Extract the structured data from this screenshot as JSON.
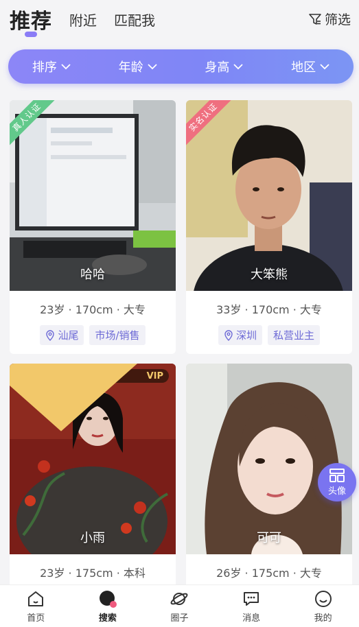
{
  "header": {
    "tabs": [
      "推荐",
      "附近",
      "匹配我"
    ],
    "active_tab": "推荐",
    "filter_label": "筛选"
  },
  "filter_bar": {
    "items": [
      "排序",
      "年龄",
      "身高",
      "地区"
    ]
  },
  "cards": [
    {
      "name": "哈哈",
      "badge": "真人认证",
      "info": "23岁 · 170cm · 大专",
      "location": "汕尾",
      "job": "市场/销售"
    },
    {
      "name": "大笨熊",
      "badge": "实名认证",
      "info": "33岁 · 170cm · 大专",
      "location": "深圳",
      "job": "私营业主"
    },
    {
      "name": "小雨",
      "badge": "VIP",
      "info": "23岁 · 175cm · 本科"
    },
    {
      "name": "可可",
      "info": "26岁 · 175cm · 大专"
    }
  ],
  "float_button": {
    "label": "头像"
  },
  "bottom_nav": {
    "items": [
      "首页",
      "搜索",
      "圈子",
      "消息",
      "我的"
    ],
    "active": "搜索"
  },
  "colors": {
    "accent": "#7f86f6",
    "tag_text": "#6d6ad6",
    "ribbon_green": "#62c98b",
    "ribbon_pink": "#ef6f7f"
  }
}
